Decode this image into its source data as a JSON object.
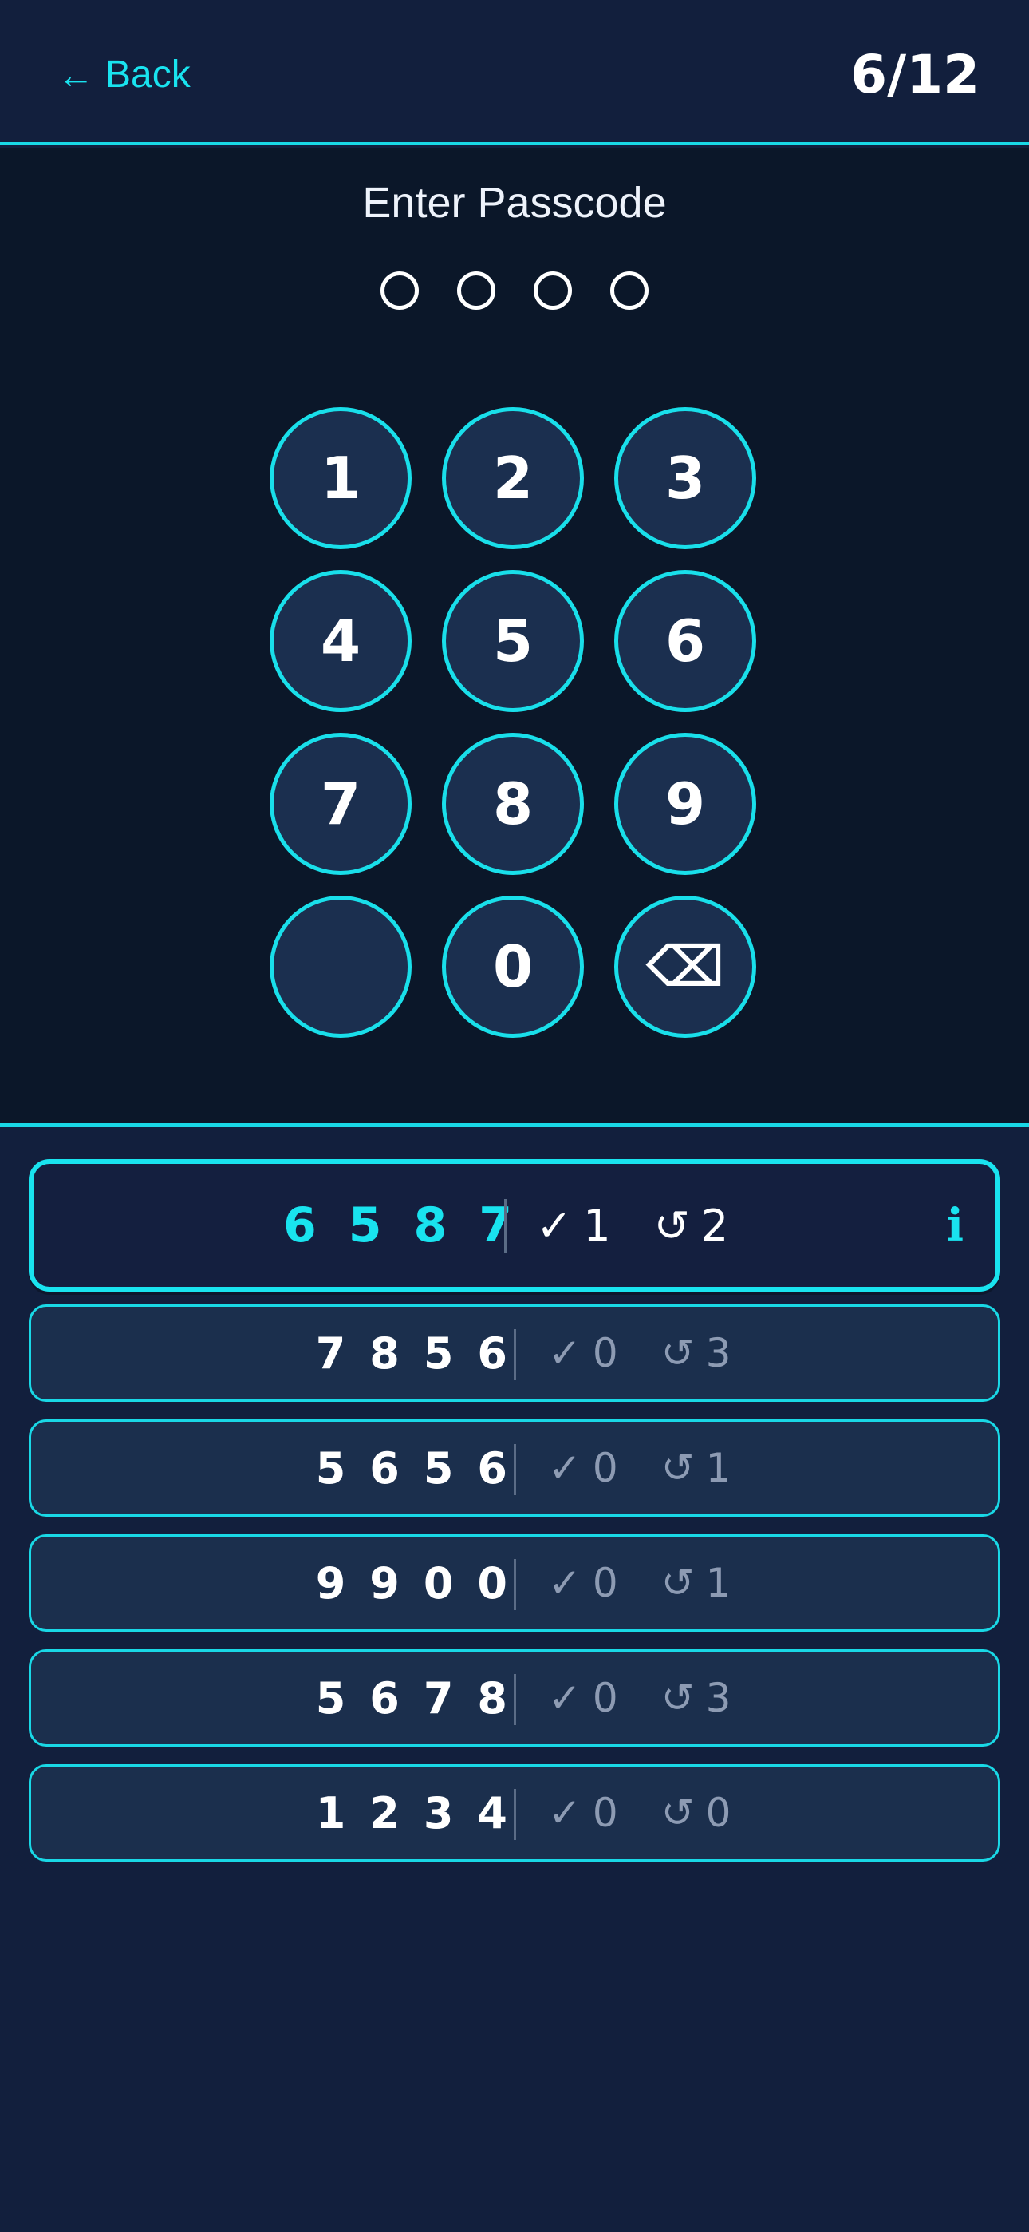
{
  "header": {
    "back_arrow": "←",
    "back_label": "Back",
    "progress": "6/12"
  },
  "passcode": {
    "prompt": "Enter Passcode",
    "entered_count": 0,
    "length": 4
  },
  "keypad": {
    "keys": [
      "1",
      "2",
      "3",
      "4",
      "5",
      "6",
      "7",
      "8",
      "9",
      "",
      "0",
      "⌫"
    ]
  },
  "feedback_icons": {
    "correct": "✓",
    "misplaced": "↺",
    "info": "i"
  },
  "history": {
    "current": {
      "digits": [
        "6",
        "5",
        "8",
        "7"
      ],
      "correct": "1",
      "misplaced": "2"
    },
    "previous": [
      {
        "digits": [
          "7",
          "8",
          "5",
          "6"
        ],
        "correct": "0",
        "misplaced": "3"
      },
      {
        "digits": [
          "5",
          "6",
          "5",
          "6"
        ],
        "correct": "0",
        "misplaced": "1"
      },
      {
        "digits": [
          "9",
          "9",
          "0",
          "0"
        ],
        "correct": "0",
        "misplaced": "1"
      },
      {
        "digits": [
          "5",
          "6",
          "7",
          "8"
        ],
        "correct": "0",
        "misplaced": "3"
      },
      {
        "digits": [
          "1",
          "2",
          "3",
          "4"
        ],
        "correct": "0",
        "misplaced": "0"
      }
    ]
  },
  "colors": {
    "accent": "#19e3ef",
    "background": "#121f3d",
    "panel": "#0b1729",
    "key_fill": "#1b2f4f"
  }
}
